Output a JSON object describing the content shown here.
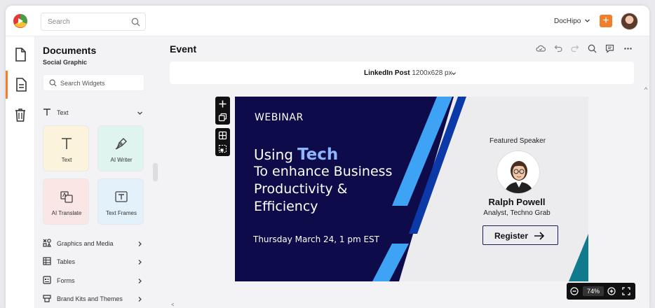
{
  "topbar": {
    "search_placeholder": "Search",
    "brand_label": "DocHipo",
    "add_label": "+"
  },
  "sidebar": {
    "title": "Documents",
    "subtitle": "Social Graphic",
    "widget_search_placeholder": "Search Widgets",
    "text_section": "Text",
    "tiles": [
      {
        "label": "Text"
      },
      {
        "label": "AI Writer"
      },
      {
        "label": "AI Translate"
      },
      {
        "label": "Text Frames"
      }
    ],
    "sections": [
      {
        "label": "Graphics and Media"
      },
      {
        "label": "Tables"
      },
      {
        "label": "Forms"
      },
      {
        "label": "Brand Kits and Themes"
      }
    ]
  },
  "main": {
    "title": "Event",
    "size_name": "LinkedIn Post",
    "size_dims": "1200x628 px"
  },
  "design": {
    "eyebrow": "WEBINAR",
    "headline_lead": "Using",
    "headline_highlight": "Tech",
    "headline_lines": [
      "To enhance Business",
      "Productivity &",
      "Efficiency"
    ],
    "date": "Thursday March 24, 1 pm EST",
    "featured_label": "Featured Speaker",
    "speaker_name": "Ralph Powell",
    "speaker_role": "Analyst, Techno Grab",
    "cta_label": "Register",
    "colors": {
      "navy": "#0d0b4a",
      "accent_blue": "#3fa3f5",
      "dark_blue": "#0b3aa8",
      "teal": "#127a8e",
      "highlight": "#8fb5ff"
    }
  },
  "zoom": {
    "value": "74%"
  },
  "accent_color": "#f07e2a"
}
